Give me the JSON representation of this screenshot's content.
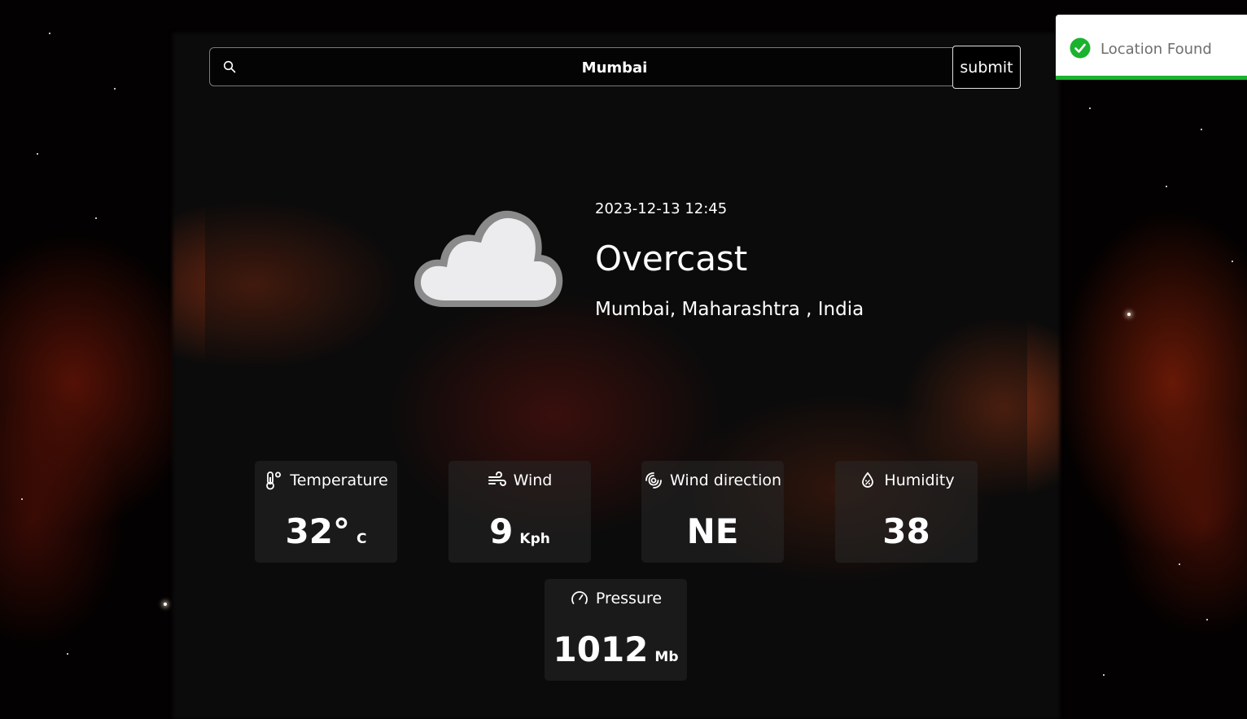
{
  "search": {
    "value": "Mumbai",
    "submit_label": "submit"
  },
  "current": {
    "datetime": "2023-12-13 12:45",
    "condition": "Overcast",
    "location": "Mumbai, Maharashtra , India",
    "condition_icon": "cloud-icon"
  },
  "stats": {
    "temperature": {
      "label": "Temperature",
      "value": "32°",
      "unit": "C",
      "icon": "thermometer-icon"
    },
    "wind": {
      "label": "Wind",
      "value": "9",
      "unit": "Kph",
      "icon": "wind-icon"
    },
    "wind_direction": {
      "label": "Wind direction",
      "value": "NE",
      "icon": "cyclone-icon"
    },
    "humidity": {
      "label": "Humidity",
      "value": "38",
      "icon": "droplet-percent-icon"
    },
    "pressure": {
      "label": "Pressure",
      "value": "1012",
      "unit": "Mb",
      "icon": "gauge-icon"
    }
  },
  "toast": {
    "message": "Location Found",
    "status_color": "#1bb22e",
    "icon": "check-circle-icon",
    "progress": 1.0
  }
}
